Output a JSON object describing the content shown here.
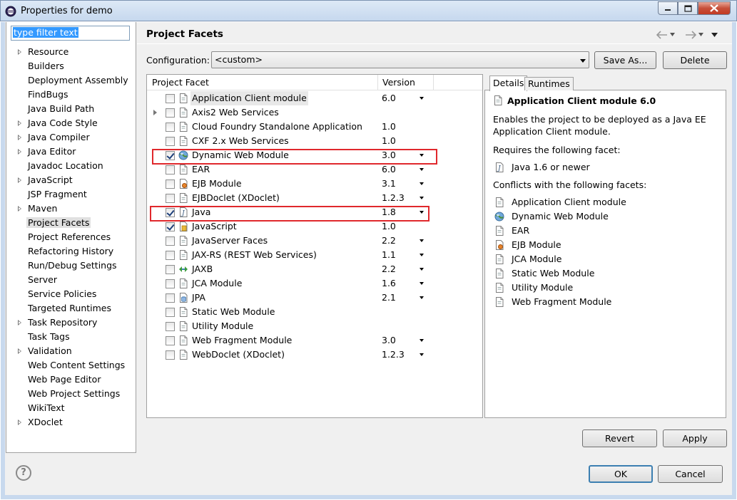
{
  "window": {
    "title": "Properties for demo",
    "controls": [
      "minimize-icon",
      "maximize-icon",
      "close-icon"
    ]
  },
  "filter": {
    "text": "type filter text"
  },
  "tree": [
    {
      "label": "Resource",
      "expandable": true
    },
    {
      "label": "Builders",
      "expandable": false
    },
    {
      "label": "Deployment Assembly",
      "expandable": false
    },
    {
      "label": "FindBugs",
      "expandable": false
    },
    {
      "label": "Java Build Path",
      "expandable": false
    },
    {
      "label": "Java Code Style",
      "expandable": true
    },
    {
      "label": "Java Compiler",
      "expandable": true
    },
    {
      "label": "Java Editor",
      "expandable": true
    },
    {
      "label": "Javadoc Location",
      "expandable": false
    },
    {
      "label": "JavaScript",
      "expandable": true
    },
    {
      "label": "JSP Fragment",
      "expandable": false
    },
    {
      "label": "Maven",
      "expandable": true
    },
    {
      "label": "Project Facets",
      "expandable": false,
      "selected": true
    },
    {
      "label": "Project References",
      "expandable": false
    },
    {
      "label": "Refactoring History",
      "expandable": false
    },
    {
      "label": "Run/Debug Settings",
      "expandable": false
    },
    {
      "label": "Server",
      "expandable": false
    },
    {
      "label": "Service Policies",
      "expandable": false
    },
    {
      "label": "Targeted Runtimes",
      "expandable": false
    },
    {
      "label": "Task Repository",
      "expandable": true
    },
    {
      "label": "Task Tags",
      "expandable": false
    },
    {
      "label": "Validation",
      "expandable": true
    },
    {
      "label": "Web Content Settings",
      "expandable": false
    },
    {
      "label": "Web Page Editor",
      "expandable": false
    },
    {
      "label": "Web Project Settings",
      "expandable": false
    },
    {
      "label": "WikiText",
      "expandable": false
    },
    {
      "label": "XDoclet",
      "expandable": true
    }
  ],
  "page": {
    "title": "Project Facets",
    "nav_icons": [
      "back-arrow-icon",
      "forward-arrow-icon"
    ]
  },
  "configuration": {
    "label": "Configuration:",
    "value": "<custom>",
    "save_as_label": "Save As...",
    "delete_label": "Delete"
  },
  "facets_table": {
    "col_facet": "Project Facet",
    "col_version": "Version",
    "rows": [
      {
        "name": "Application Client module",
        "version": "6.0",
        "checked": false,
        "has_dropdown": true,
        "expandable": false,
        "icon": "page",
        "highlighted": true
      },
      {
        "name": "Axis2 Web Services",
        "version": "",
        "checked": false,
        "has_dropdown": false,
        "expandable": true,
        "icon": "page"
      },
      {
        "name": "Cloud Foundry Standalone Application",
        "version": "1.0",
        "checked": false,
        "has_dropdown": false,
        "expandable": false,
        "icon": "page"
      },
      {
        "name": "CXF 2.x Web Services",
        "version": "1.0",
        "checked": false,
        "has_dropdown": false,
        "expandable": false,
        "icon": "page"
      },
      {
        "name": "Dynamic Web Module",
        "version": "3.0",
        "checked": true,
        "has_dropdown": true,
        "expandable": false,
        "icon": "web"
      },
      {
        "name": "EAR",
        "version": "6.0",
        "checked": false,
        "has_dropdown": true,
        "expandable": false,
        "icon": "page"
      },
      {
        "name": "EJB Module",
        "version": "3.1",
        "checked": false,
        "has_dropdown": true,
        "expandable": false,
        "icon": "ejb"
      },
      {
        "name": "EJBDoclet (XDoclet)",
        "version": "1.2.3",
        "checked": false,
        "has_dropdown": true,
        "expandable": false,
        "icon": "page"
      },
      {
        "name": "Java",
        "version": "1.8",
        "checked": true,
        "has_dropdown": true,
        "expandable": false,
        "icon": "java"
      },
      {
        "name": "JavaScript",
        "version": "1.0",
        "checked": true,
        "has_dropdown": false,
        "expandable": false,
        "icon": "js"
      },
      {
        "name": "JavaServer Faces",
        "version": "2.2",
        "checked": false,
        "has_dropdown": true,
        "expandable": false,
        "icon": "page"
      },
      {
        "name": "JAX-RS (REST Web Services)",
        "version": "1.1",
        "checked": false,
        "has_dropdown": true,
        "expandable": false,
        "icon": "page"
      },
      {
        "name": "JAXB",
        "version": "2.2",
        "checked": false,
        "has_dropdown": true,
        "expandable": false,
        "icon": "jaxb"
      },
      {
        "name": "JCA Module",
        "version": "1.6",
        "checked": false,
        "has_dropdown": true,
        "expandable": false,
        "icon": "page"
      },
      {
        "name": "JPA",
        "version": "2.1",
        "checked": false,
        "has_dropdown": true,
        "expandable": false,
        "icon": "jpa"
      },
      {
        "name": "Static Web Module",
        "version": "",
        "checked": false,
        "has_dropdown": false,
        "expandable": false,
        "icon": "page"
      },
      {
        "name": "Utility Module",
        "version": "",
        "checked": false,
        "has_dropdown": false,
        "expandable": false,
        "icon": "page"
      },
      {
        "name": "Web Fragment Module",
        "version": "3.0",
        "checked": false,
        "has_dropdown": true,
        "expandable": false,
        "icon": "page"
      },
      {
        "name": "WebDoclet (XDoclet)",
        "version": "1.2.3",
        "checked": false,
        "has_dropdown": true,
        "expandable": false,
        "icon": "page"
      }
    ]
  },
  "details": {
    "tab_details": "Details",
    "tab_runtimes": "Runtimes",
    "title": "Application Client module 6.0",
    "description": "Enables the project to be deployed as a Java EE Application Client module.",
    "requires_label": "Requires the following facet:",
    "requires": [
      {
        "name": "Java 1.6 or newer",
        "icon": "java"
      }
    ],
    "conflicts_label": "Conflicts with the following facets:",
    "conflicts": [
      {
        "name": "Application Client module",
        "icon": "page"
      },
      {
        "name": "Dynamic Web Module",
        "icon": "web"
      },
      {
        "name": "EAR",
        "icon": "page"
      },
      {
        "name": "EJB Module",
        "icon": "ejb"
      },
      {
        "name": "JCA Module",
        "icon": "page"
      },
      {
        "name": "Static Web Module",
        "icon": "page"
      },
      {
        "name": "Utility Module",
        "icon": "page"
      },
      {
        "name": "Web Fragment Module",
        "icon": "page"
      }
    ]
  },
  "buttons": {
    "revert": "Revert",
    "apply": "Apply",
    "ok": "OK",
    "cancel": "Cancel",
    "help": "?"
  },
  "colors": {
    "highlight_box": "#e0282c",
    "default_button_border": "#3c7fb1",
    "selection": "#3399ff"
  }
}
